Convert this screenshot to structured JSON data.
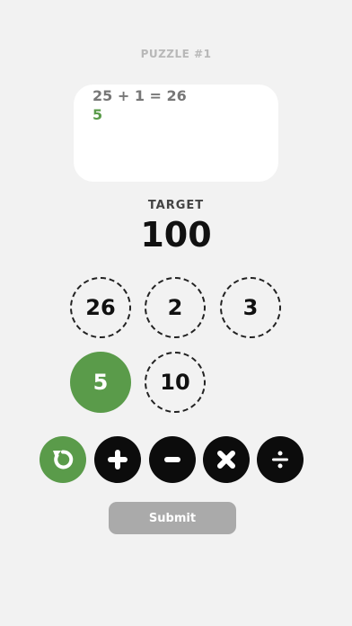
{
  "header": {
    "title": "PUZZLE #1"
  },
  "work": {
    "lines": [
      {
        "text": "25 + 1 = 26",
        "color": "#777777"
      },
      {
        "text": "5",
        "color": "#5a9b4a"
      }
    ]
  },
  "target": {
    "label": "TARGET",
    "value": "100"
  },
  "numbers": [
    {
      "value": "26",
      "selected": false
    },
    {
      "value": "2",
      "selected": false
    },
    {
      "value": "3",
      "selected": false
    },
    {
      "value": "5",
      "selected": true
    },
    {
      "value": "10",
      "selected": false
    }
  ],
  "operators": [
    {
      "name": "undo",
      "icon": "undo-icon"
    },
    {
      "name": "add",
      "icon": "plus-icon"
    },
    {
      "name": "subtract",
      "icon": "minus-icon"
    },
    {
      "name": "multiply",
      "icon": "times-icon"
    },
    {
      "name": "divide",
      "icon": "divide-icon"
    }
  ],
  "submit": {
    "label": "Submit"
  },
  "colors": {
    "accent": "#5a9b4a",
    "background": "#f2f2f2",
    "disabled": "#aaaaaa"
  }
}
